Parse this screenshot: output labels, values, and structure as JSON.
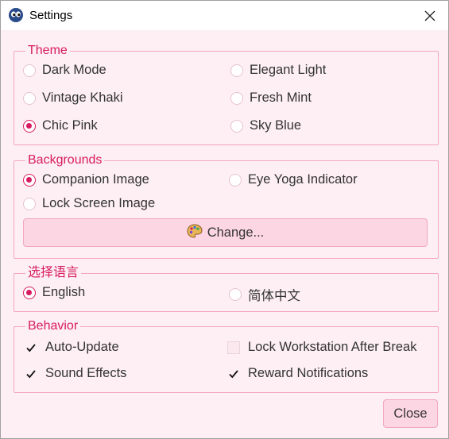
{
  "window": {
    "title": "Settings"
  },
  "theme": {
    "title": "Theme",
    "options": [
      {
        "label": "Dark Mode",
        "selected": false
      },
      {
        "label": "Elegant Light",
        "selected": false
      },
      {
        "label": "Vintage Khaki",
        "selected": false
      },
      {
        "label": "Fresh Mint",
        "selected": false
      },
      {
        "label": "Chic Pink",
        "selected": true
      },
      {
        "label": "Sky Blue",
        "selected": false
      }
    ]
  },
  "backgrounds": {
    "title": "Backgrounds",
    "options": [
      {
        "label": "Companion Image",
        "selected": true
      },
      {
        "label": "Eye Yoga Indicator",
        "selected": false
      },
      {
        "label": "Lock Screen Image",
        "selected": false
      }
    ],
    "change_label": "Change..."
  },
  "language": {
    "title": "选择语言",
    "options": [
      {
        "label": "English",
        "selected": true
      },
      {
        "label": "简体中文",
        "selected": false
      }
    ]
  },
  "behavior": {
    "title": "Behavior",
    "options": [
      {
        "label": "Auto-Update",
        "checked": true
      },
      {
        "label": "Lock Workstation After Break",
        "checked": false
      },
      {
        "label": "Sound Effects",
        "checked": true
      },
      {
        "label": "Reward Notifications",
        "checked": true
      }
    ]
  },
  "footer": {
    "close_label": "Close"
  },
  "colors": {
    "accent": "#d81b60",
    "background": "#fdeff3",
    "button": "#fdd6e3",
    "border": "#f2a7bf"
  }
}
